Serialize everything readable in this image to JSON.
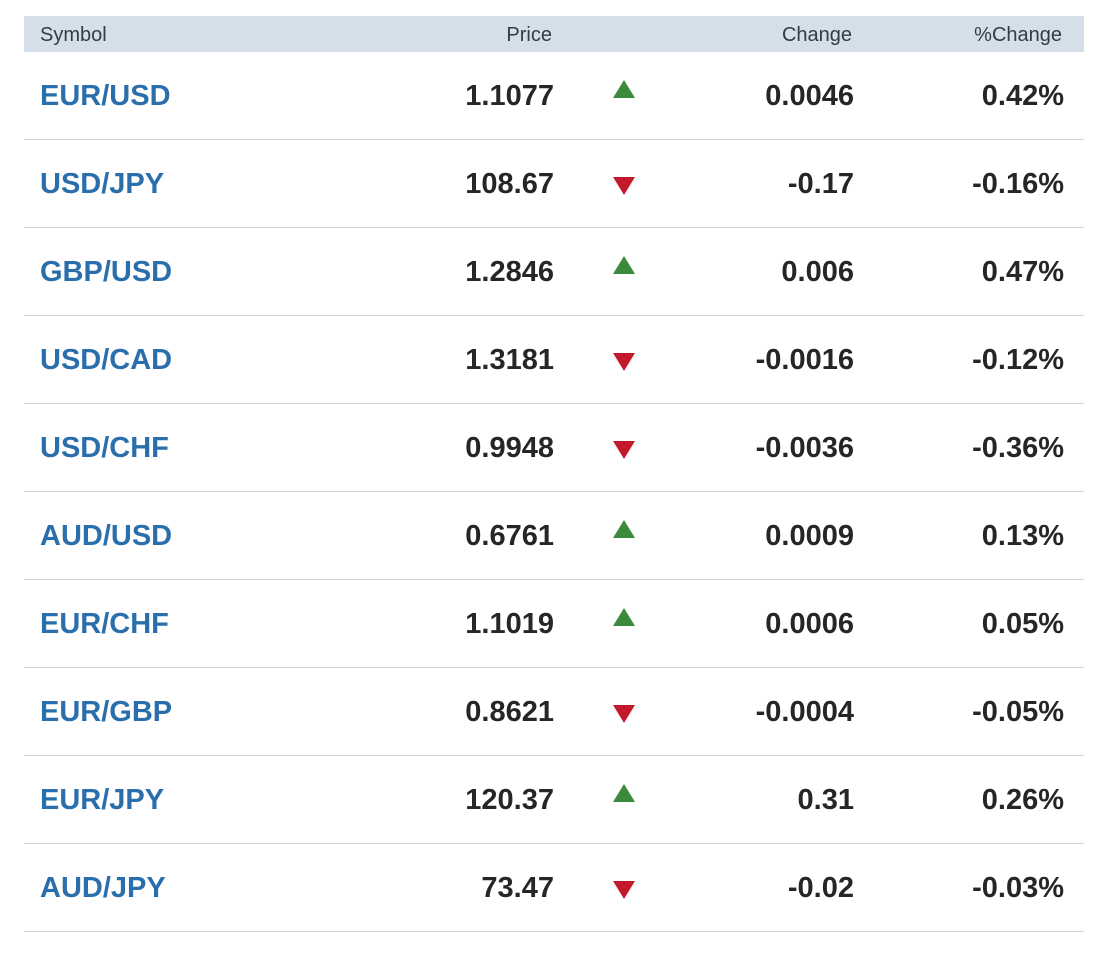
{
  "header": {
    "symbol": "Symbol",
    "price": "Price",
    "change": "Change",
    "pct_change": "%Change"
  },
  "colors": {
    "up": "#3a8a3a",
    "down": "#c21a2b",
    "symbol_link": "#2a6fab",
    "header_bg": "#d5dfe9"
  },
  "rows": [
    {
      "symbol": "EUR/USD",
      "price": "1.1077",
      "direction": "up",
      "arrow_icon": "triangle-up-icon",
      "change": "0.0046",
      "pct_change": "0.42%"
    },
    {
      "symbol": "USD/JPY",
      "price": "108.67",
      "direction": "down",
      "arrow_icon": "triangle-down-icon",
      "change": "-0.17",
      "pct_change": "-0.16%"
    },
    {
      "symbol": "GBP/USD",
      "price": "1.2846",
      "direction": "up",
      "arrow_icon": "triangle-up-icon",
      "change": "0.006",
      "pct_change": "0.47%"
    },
    {
      "symbol": "USD/CAD",
      "price": "1.3181",
      "direction": "down",
      "arrow_icon": "triangle-down-icon",
      "change": "-0.0016",
      "pct_change": "-0.12%"
    },
    {
      "symbol": "USD/CHF",
      "price": "0.9948",
      "direction": "down",
      "arrow_icon": "triangle-down-icon",
      "change": "-0.0036",
      "pct_change": "-0.36%"
    },
    {
      "symbol": "AUD/USD",
      "price": "0.6761",
      "direction": "up",
      "arrow_icon": "triangle-up-icon",
      "change": "0.0009",
      "pct_change": "0.13%"
    },
    {
      "symbol": "EUR/CHF",
      "price": "1.1019",
      "direction": "up",
      "arrow_icon": "triangle-up-icon",
      "change": "0.0006",
      "pct_change": "0.05%"
    },
    {
      "symbol": "EUR/GBP",
      "price": "0.8621",
      "direction": "down",
      "arrow_icon": "triangle-down-icon",
      "change": "-0.0004",
      "pct_change": "-0.05%"
    },
    {
      "symbol": "EUR/JPY",
      "price": "120.37",
      "direction": "up",
      "arrow_icon": "triangle-up-icon",
      "change": "0.31",
      "pct_change": "0.26%"
    },
    {
      "symbol": "AUD/JPY",
      "price": "73.47",
      "direction": "down",
      "arrow_icon": "triangle-down-icon",
      "change": "-0.02",
      "pct_change": "-0.03%"
    }
  ]
}
